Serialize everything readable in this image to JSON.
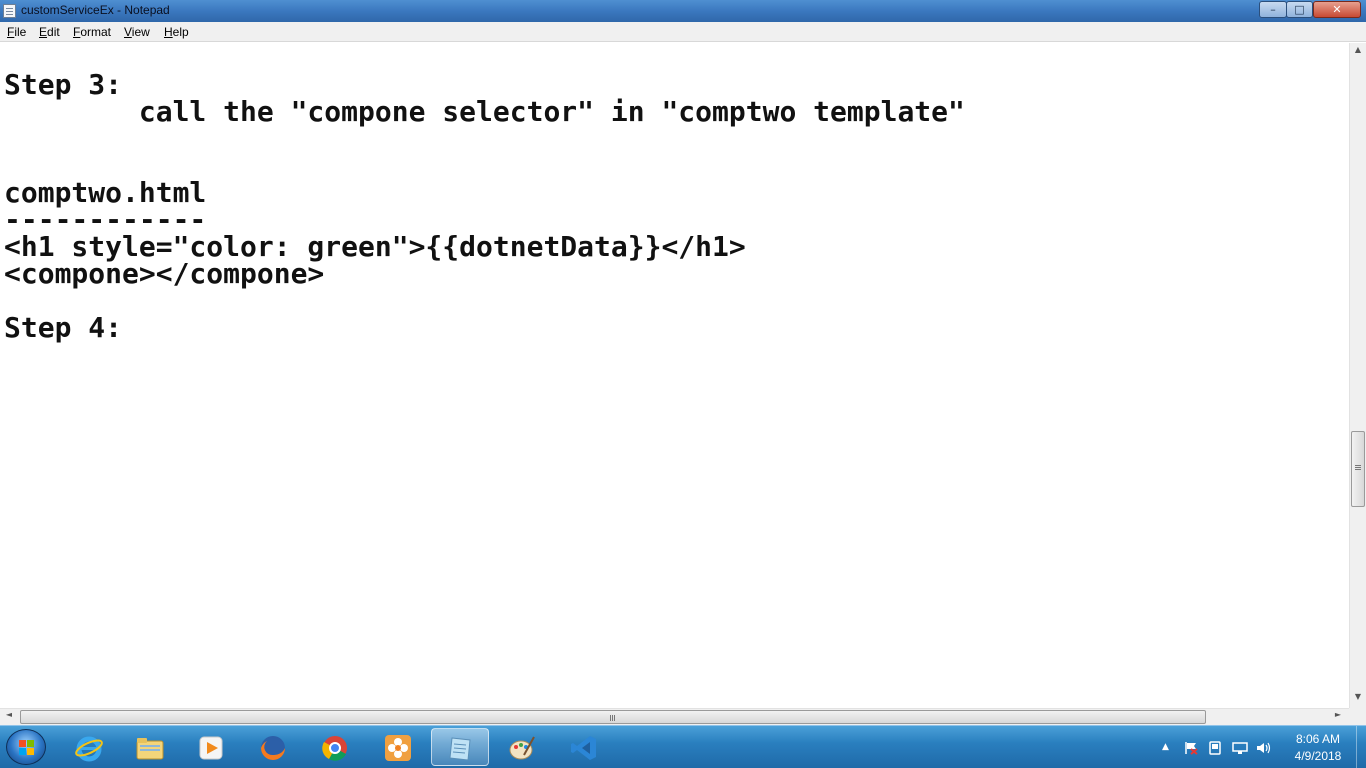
{
  "window": {
    "title": "customServiceEx - Notepad",
    "minimize_glyph": "–",
    "maximize_glyph": "□",
    "close_glyph": "✕"
  },
  "menu": {
    "file": "File",
    "edit": "Edit",
    "format": "Format",
    "view": "View",
    "help": "Help"
  },
  "document": {
    "lines": [
      "Step 3:",
      "        call the \"compone selector\" in \"comptwo template\"",
      "",
      "",
      "comptwo.html",
      "------------",
      "<h1 style=\"color: green\">{{dotnetData}}</h1>",
      "<compone></compone>",
      "",
      "Step 4:"
    ]
  },
  "scrollbars": {
    "up_glyph": "▲",
    "down_glyph": "▼",
    "left_glyph": "◄",
    "right_glyph": "►"
  },
  "taskbar": {
    "apps": [
      {
        "name": "Internet Explorer",
        "icon": "ie-icon"
      },
      {
        "name": "Windows Explorer",
        "icon": "folder-icon"
      },
      {
        "name": "Windows Media Player",
        "icon": "media-player-icon"
      },
      {
        "name": "Firefox",
        "icon": "firefox-icon"
      },
      {
        "name": "Chrome",
        "icon": "chrome-icon"
      },
      {
        "name": "Snipping/Flower app",
        "icon": "flower-icon"
      },
      {
        "name": "Notepad",
        "icon": "notepad-icon",
        "active": true
      },
      {
        "name": "Paint",
        "icon": "paint-icon"
      },
      {
        "name": "Visual Studio Code",
        "icon": "vscode-icon"
      }
    ]
  },
  "tray": {
    "time": "8:06 AM",
    "date": "4/9/2018",
    "show_hidden_glyph": "▲"
  },
  "colors": {
    "titlebar": "#3b78bf",
    "taskbar": "#2a7fbf",
    "editor_bg": "#ffffff",
    "text": "#111111"
  }
}
